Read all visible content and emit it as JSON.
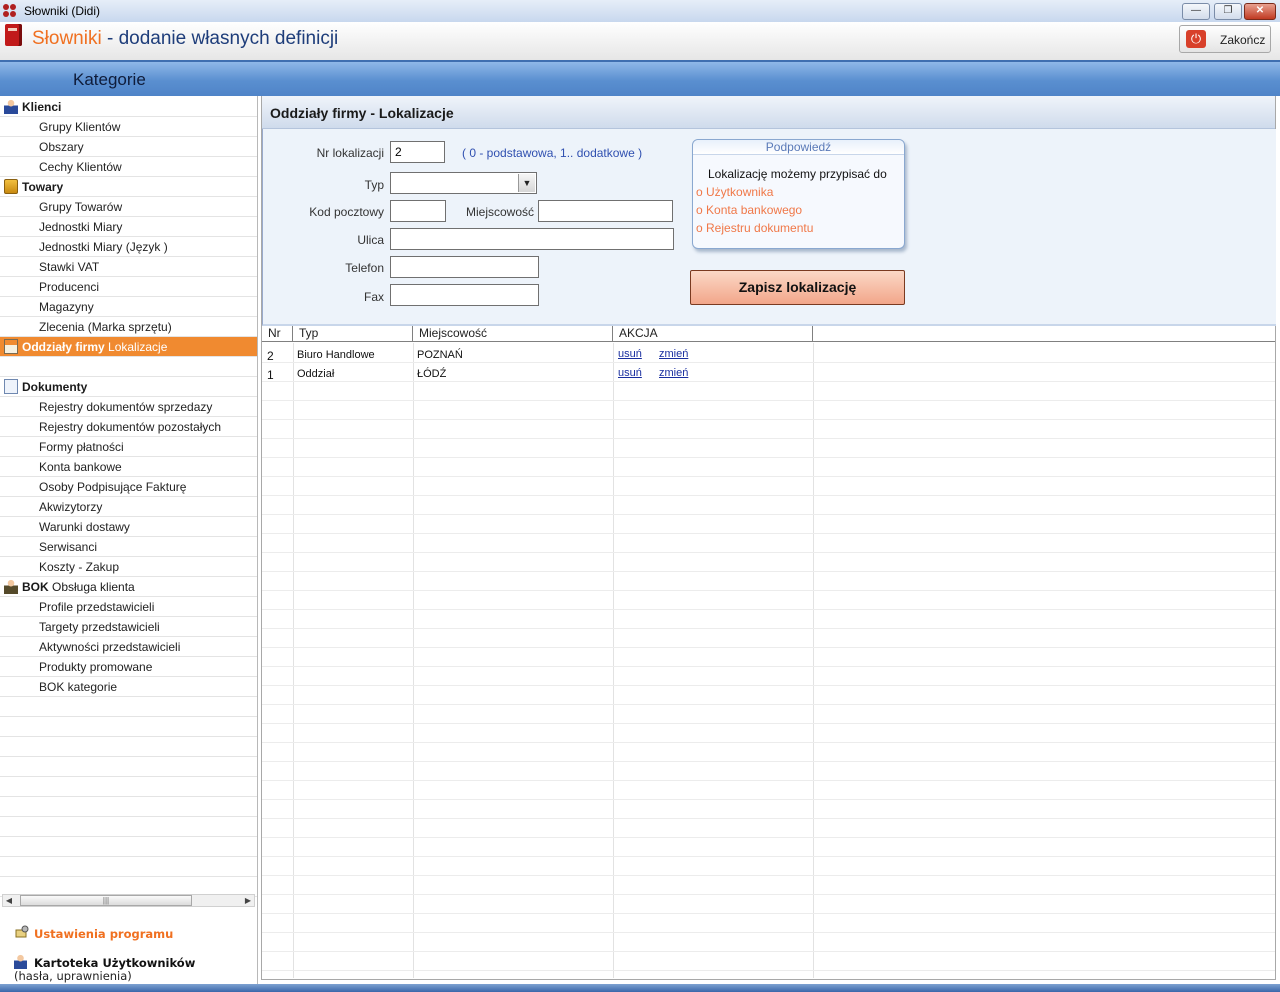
{
  "window": {
    "title": "Słowniki (Didi)"
  },
  "header": {
    "title_accent": "Słowniki",
    "title_rest": " - dodanie własnych definicji",
    "exit_label": "Zakończ"
  },
  "band": {
    "label": "Kategorie"
  },
  "sidebar": {
    "groups": [
      {
        "name": "Klienci",
        "icon": "person-icon",
        "items": [
          "Grupy Klientów",
          "Obszary",
          "Cechy Klientów"
        ]
      },
      {
        "name": "Towary",
        "icon": "box-icon",
        "items": [
          "Grupy Towarów",
          "Jednostki Miary",
          "Jednostki Miary (Język )",
          "Stawki VAT",
          "Producenci",
          "Magazyny",
          "Zlecenia (Marka sprzętu)"
        ]
      },
      {
        "name_bold": "Oddziały firmy",
        "name_rest": " Lokalizacje",
        "icon": "house-icon",
        "active": true
      },
      {
        "name": "Dokumenty",
        "icon": "document-icon",
        "items": [
          "Rejestry dokumentów sprzedazy",
          "Rejestry dokumentów pozostałych",
          "Formy płatności",
          "Konta bankowe",
          "Osoby Podpisujące Fakturę",
          "Akwizytorzy",
          "Warunki dostawy",
          "Serwisanci",
          "Koszty - Zakup"
        ]
      },
      {
        "name_bold": "BOK",
        "name_rest": " Obsługa klienta",
        "icon": "bok-person-icon",
        "items": [
          "Profile przedstawicieli",
          "Targety przedstawicieli",
          "Aktywności przedstawicieli",
          "Produkty promowane",
          "BOK kategorie"
        ]
      }
    ],
    "settings_link": "Ustawienia programu",
    "users_link": "Kartoteka Użytkowników",
    "users_sub": "(hasła, uprawnienia)"
  },
  "main": {
    "title": "Oddziały firmy - Lokalizacje",
    "form": {
      "nr_label": "Nr lokalizacji",
      "nr_value": "2",
      "nr_hint": "( 0 - podstawowa, 1..  dodatkowe )",
      "typ_label": "Typ",
      "typ_value": "",
      "kod_label": "Kod pocztowy",
      "kod_value": "",
      "miejscowosc_label": "Miejscowość",
      "miejscowosc_value": "",
      "ulica_label": "Ulica",
      "ulica_value": "",
      "telefon_label": "Telefon",
      "telefon_value": "",
      "fax_label": "Fax",
      "fax_value": ""
    },
    "tip": {
      "title": "Podpowiedź",
      "intro": "Lokalizację  możemy przypisać  do",
      "items": [
        "Użytkownika",
        "Konta bankowego",
        "Rejestru dokumentu"
      ]
    },
    "save_label": "Zapisz lokalizację",
    "table": {
      "columns": [
        "Nr",
        "Typ",
        "Miejscowość",
        "AKCJA"
      ],
      "rows": [
        {
          "nr": "2",
          "typ": "Biuro Handlowe",
          "miejscowosc": "POZNAŃ",
          "delete": "usuń",
          "edit": "zmień"
        },
        {
          "nr": "1",
          "typ": "Oddział",
          "miejscowosc": "ŁÓDŹ",
          "delete": "usuń",
          "edit": "zmień"
        }
      ]
    }
  },
  "colors": {
    "accent": "#f07020",
    "active_row": "#f08a30",
    "band": "#5a8fd0",
    "link": "#1a2fa0"
  }
}
